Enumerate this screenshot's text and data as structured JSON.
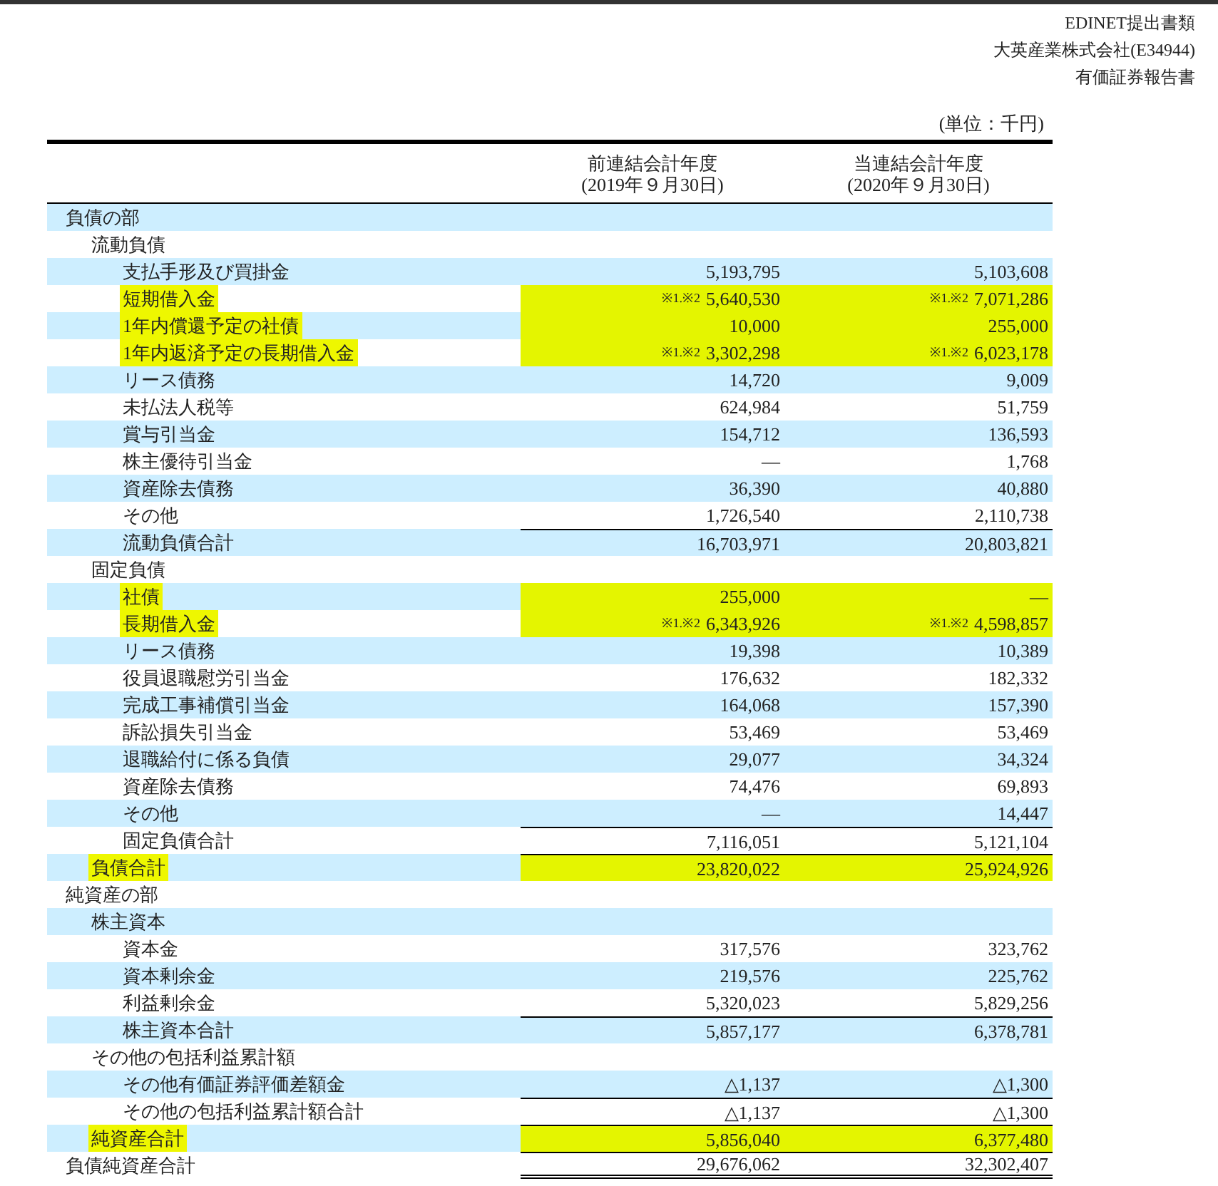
{
  "doc_header": [
    "EDINET提出書類",
    "大英産業株式会社(E34944)",
    "有価証券報告書"
  ],
  "unit": "(単位：千円)",
  "columns": [
    {
      "title": "前連結会計年度",
      "date": "(2019年９月30日)"
    },
    {
      "title": "当連結会計年度",
      "date": "(2020年９月30日)"
    }
  ],
  "rows": [
    {
      "label": "負債の部",
      "kind": "header",
      "children": [
        {
          "label": "流動負債",
          "kind": "header",
          "children": [
            {
              "label": "支払手形及び買掛金",
              "kind": "item",
              "highlighted": false,
              "values": [
                {
                  "value": "5,193,795"
                },
                {
                  "value": "5,103,608"
                }
              ]
            },
            {
              "label": "短期借入金",
              "kind": "item",
              "highlighted": true,
              "values": [
                {
                  "note": "※1.※2",
                  "value": "5,640,530"
                },
                {
                  "note": "※1.※2",
                  "value": "7,071,286"
                }
              ]
            },
            {
              "label": "1年内償還予定の社債",
              "kind": "item",
              "highlighted": true,
              "values": [
                {
                  "value": "10,000"
                },
                {
                  "value": "255,000"
                }
              ]
            },
            {
              "label": "1年内返済予定の長期借入金",
              "kind": "item",
              "highlighted": true,
              "values": [
                {
                  "note": "※1.※2",
                  "value": "3,302,298"
                },
                {
                  "note": "※1.※2",
                  "value": "6,023,178"
                }
              ]
            },
            {
              "label": "リース債務",
              "kind": "item",
              "highlighted": false,
              "values": [
                {
                  "value": "14,720"
                },
                {
                  "value": "9,009"
                }
              ]
            },
            {
              "label": "未払法人税等",
              "kind": "item",
              "highlighted": false,
              "values": [
                {
                  "value": "624,984"
                },
                {
                  "value": "51,759"
                }
              ]
            },
            {
              "label": "賞与引当金",
              "kind": "item",
              "highlighted": false,
              "values": [
                {
                  "value": "154,712"
                },
                {
                  "value": "136,593"
                }
              ]
            },
            {
              "label": "株主優待引当金",
              "kind": "item",
              "highlighted": false,
              "values": [
                {
                  "value": "―"
                },
                {
                  "value": "1,768"
                }
              ]
            },
            {
              "label": "資産除去債務",
              "kind": "item",
              "highlighted": false,
              "values": [
                {
                  "value": "36,390"
                },
                {
                  "value": "40,880"
                }
              ]
            },
            {
              "label": "その他",
              "kind": "item",
              "highlighted": false,
              "values": [
                {
                  "value": "1,726,540"
                },
                {
                  "value": "2,110,738"
                }
              ]
            },
            {
              "label": "流動負債合計",
              "kind": "total",
              "highlighted": false,
              "values": [
                {
                  "value": "16,703,971"
                },
                {
                  "value": "20,803,821"
                }
              ]
            }
          ]
        },
        {
          "label": "固定負債",
          "kind": "header",
          "children": [
            {
              "label": "社債",
              "kind": "item",
              "highlighted": true,
              "values": [
                {
                  "value": "255,000"
                },
                {
                  "value": "―"
                }
              ]
            },
            {
              "label": "長期借入金",
              "kind": "item",
              "highlighted": true,
              "values": [
                {
                  "note": "※1.※2",
                  "value": "6,343,926"
                },
                {
                  "note": "※1.※2",
                  "value": "4,598,857"
                }
              ]
            },
            {
              "label": "リース債務",
              "kind": "item",
              "highlighted": false,
              "values": [
                {
                  "value": "19,398"
                },
                {
                  "value": "10,389"
                }
              ]
            },
            {
              "label": "役員退職慰労引当金",
              "kind": "item",
              "highlighted": false,
              "values": [
                {
                  "value": "176,632"
                },
                {
                  "value": "182,332"
                }
              ]
            },
            {
              "label": "完成工事補償引当金",
              "kind": "item",
              "highlighted": false,
              "values": [
                {
                  "value": "164,068"
                },
                {
                  "value": "157,390"
                }
              ]
            },
            {
              "label": "訴訟損失引当金",
              "kind": "item",
              "highlighted": false,
              "values": [
                {
                  "value": "53,469"
                },
                {
                  "value": "53,469"
                }
              ]
            },
            {
              "label": "退職給付に係る負債",
              "kind": "item",
              "highlighted": false,
              "values": [
                {
                  "value": "29,077"
                },
                {
                  "value": "34,324"
                }
              ]
            },
            {
              "label": "資産除去債務",
              "kind": "item",
              "highlighted": false,
              "values": [
                {
                  "value": "74,476"
                },
                {
                  "value": "69,893"
                }
              ]
            },
            {
              "label": "その他",
              "kind": "item",
              "highlighted": false,
              "values": [
                {
                  "value": "―"
                },
                {
                  "value": "14,447"
                }
              ]
            },
            {
              "label": "固定負債合計",
              "kind": "total",
              "highlighted": false,
              "values": [
                {
                  "value": "7,116,051"
                },
                {
                  "value": "5,121,104"
                }
              ]
            }
          ]
        },
        {
          "label": "負債合計",
          "kind": "total",
          "highlighted": true,
          "values": [
            {
              "value": "23,820,022"
            },
            {
              "value": "25,924,926"
            }
          ]
        }
      ]
    },
    {
      "label": "純資産の部",
      "kind": "header",
      "children": [
        {
          "label": "株主資本",
          "kind": "header",
          "children": [
            {
              "label": "資本金",
              "kind": "item",
              "highlighted": false,
              "values": [
                {
                  "value": "317,576"
                },
                {
                  "value": "323,762"
                }
              ]
            },
            {
              "label": "資本剰余金",
              "kind": "item",
              "highlighted": false,
              "values": [
                {
                  "value": "219,576"
                },
                {
                  "value": "225,762"
                }
              ]
            },
            {
              "label": "利益剰余金",
              "kind": "item",
              "highlighted": false,
              "values": [
                {
                  "value": "5,320,023"
                },
                {
                  "value": "5,829,256"
                }
              ]
            },
            {
              "label": "株主資本合計",
              "kind": "total",
              "highlighted": false,
              "values": [
                {
                  "value": "5,857,177"
                },
                {
                  "value": "6,378,781"
                }
              ]
            }
          ]
        },
        {
          "label": "その他の包括利益累計額",
          "kind": "header",
          "children": [
            {
              "label": "その他有価証券評価差額金",
              "kind": "item",
              "highlighted": false,
              "values": [
                {
                  "value": "△1,137"
                },
                {
                  "value": "△1,300"
                }
              ]
            },
            {
              "label": "その他の包括利益累計額合計",
              "kind": "total",
              "highlighted": false,
              "values": [
                {
                  "value": "△1,137"
                },
                {
                  "value": "△1,300"
                }
              ]
            }
          ]
        },
        {
          "label": "純資産合計",
          "kind": "total",
          "highlighted": true,
          "values": [
            {
              "value": "5,856,040"
            },
            {
              "value": "6,377,480"
            }
          ]
        }
      ]
    },
    {
      "label": "負債純資産合計",
      "kind": "grand_total",
      "highlighted": false,
      "values": [
        {
          "value": "29,676,062"
        },
        {
          "value": "32,302,407"
        }
      ]
    }
  ]
}
